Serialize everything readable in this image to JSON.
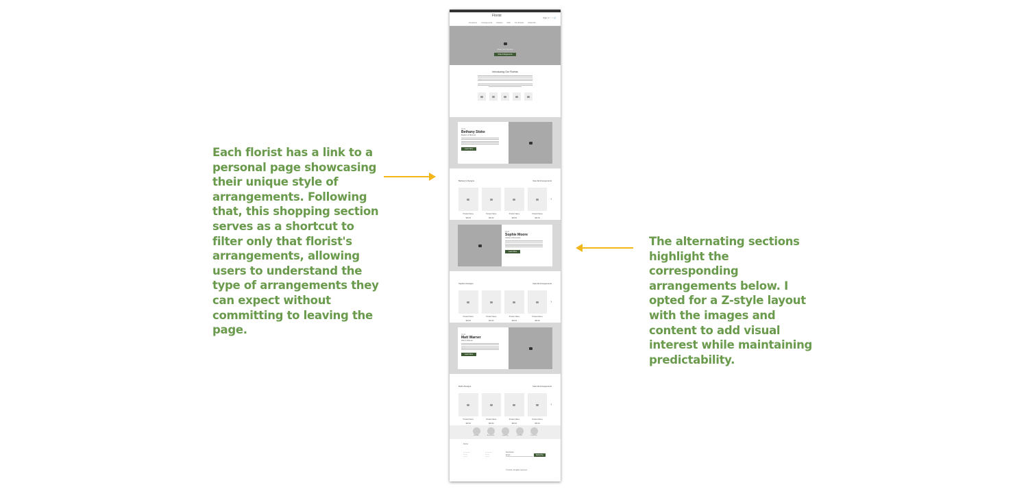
{
  "annotations": {
    "left": "Each florist has a link to a personal page showcasing their unique style of arrangements. Following that, this shopping section serves as a shortcut to filter only that florist's arrangements, allowing users to understand the type of arrangements they can expect without committing to leaving the page.",
    "right": "The alternating sections highlight the corresponding arrangements below. I opted for a Z-style layout with the images and content to add visual interest while maintaining predictability."
  },
  "colors": {
    "annotation": "#6a9a4c",
    "arrow": "#f2b619",
    "button": "#3d5a34"
  },
  "wireframe": {
    "logo": "Florist",
    "header_links": "Sign in  ♡  ⌕  🛒",
    "nav": [
      "Occasions",
      "Arrangements",
      "Flowers",
      "Gifts",
      "Our Florists",
      "Subscribe"
    ],
    "hero": {
      "title": "Meet Our Florists",
      "button": "Shop Arrangements"
    },
    "intro": {
      "title": "Introducing Our Florists"
    },
    "florists": [
      {
        "label": "Florist",
        "name": "Bethany Stoke",
        "subtitle": "Modern & Minimal",
        "button": "Learn More",
        "image_side": "right",
        "shop_title": "Bethany's Designs",
        "view_all": "View All Arrangements"
      },
      {
        "label": "Florist",
        "name": "Sophie Moore",
        "subtitle": "Classic & Romantic",
        "button": "Learn More",
        "image_side": "left",
        "shop_title": "Sophie's Designs",
        "view_all": "View All Arrangements"
      },
      {
        "label": "Florist",
        "name": "Matt Warner",
        "subtitle": "Wild & Natural",
        "button": "Learn More",
        "image_side": "right",
        "shop_title": "Matt's Designs",
        "view_all": "View All Arrangements"
      }
    ],
    "product_names": [
      "Product Name",
      "Product Name",
      "Product Name",
      "Product Name"
    ],
    "product_price": "$00.00",
    "categories": [
      "Birthday",
      "Anniversary",
      "Sympathy",
      "Get Well",
      "Thank You"
    ],
    "footer": {
      "newsletter": "Newsletter",
      "email_placeholder": "Email",
      "subscribe": "Subscribe",
      "copyright": "© Florist. All rights reserved."
    }
  }
}
